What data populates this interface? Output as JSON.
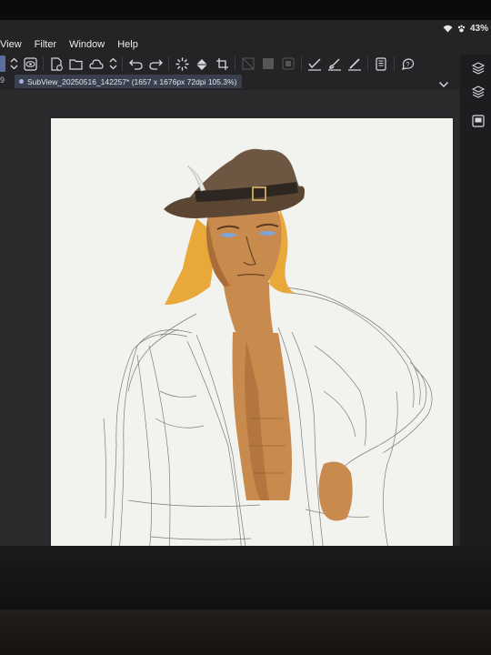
{
  "status_bar": {
    "battery": "43%",
    "wifi_icon": "wifi-icon",
    "paw_icon": "paw-icon"
  },
  "menu": {
    "items": [
      "View",
      "Filter",
      "Window",
      "Help"
    ]
  },
  "toolbar": {
    "icons": [
      "move-icon",
      "layer-view-icon",
      "new-canvas-icon",
      "open-folder-icon",
      "save-cloud-icon",
      "stepper-icon",
      "undo-icon",
      "redo-icon",
      "loading-icon",
      "fill-icon",
      "crop-icon",
      "grid-icon",
      "layer-mask-icon",
      "clip-icon",
      "check-brush-icon",
      "brush-icon",
      "pen-icon",
      "device-icon",
      "help-icon"
    ]
  },
  "tab": {
    "number": "9",
    "title": "SubView_20250516_142257* (1657 x 1676px 72dpi 105.3%)"
  },
  "right_panel": {
    "icons": [
      "layers-icon",
      "layer-stack-icon",
      "frame-icon"
    ]
  },
  "colors": {
    "screen_bg": "#242427",
    "canvas_bg": "#f2f2ef",
    "tab_bg": "#3a3f4d",
    "hat": "#6e5742",
    "hair": "#e8a83a",
    "skin": "#c98a4e",
    "skin_shadow": "#a96d38"
  }
}
